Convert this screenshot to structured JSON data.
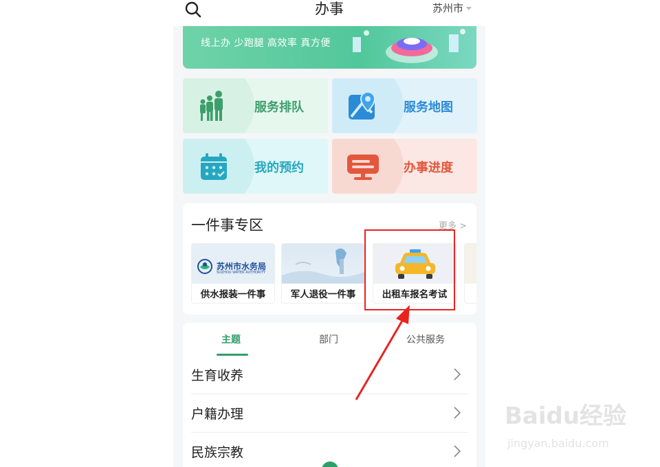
{
  "header": {
    "title": "办事",
    "city": "苏州市"
  },
  "banner": {
    "slogan": "线上办 少跑腿 高效率 真方便"
  },
  "services": [
    {
      "label": "服务排队",
      "icon": "people-queue-icon"
    },
    {
      "label": "服务地图",
      "icon": "map-pin-icon"
    },
    {
      "label": "我的预约",
      "icon": "calendar-icon"
    },
    {
      "label": "办事进度",
      "icon": "progress-monitor-icon"
    }
  ],
  "zone": {
    "title": "一件事专区",
    "more": "更多 >",
    "cards": [
      {
        "caption": "供水报装一件事",
        "logo_text": "苏州市水务局",
        "logo_sub": "SUZHOU WATER AUTHORITY"
      },
      {
        "caption": "军人退役一件事"
      },
      {
        "caption": "出租车报名考试"
      }
    ]
  },
  "tabs": [
    {
      "label": "主题",
      "active": true
    },
    {
      "label": "部门",
      "active": false
    },
    {
      "label": "公共服务",
      "active": false
    }
  ],
  "list": [
    {
      "label": "生育收养"
    },
    {
      "label": "户籍办理"
    },
    {
      "label": "民族宗教"
    }
  ],
  "watermark": {
    "logo": "Baidu经验",
    "sub": "jingyan.baidu.com"
  },
  "colors": {
    "accent": "#2f9e6a",
    "highlight": "#e8231f"
  }
}
